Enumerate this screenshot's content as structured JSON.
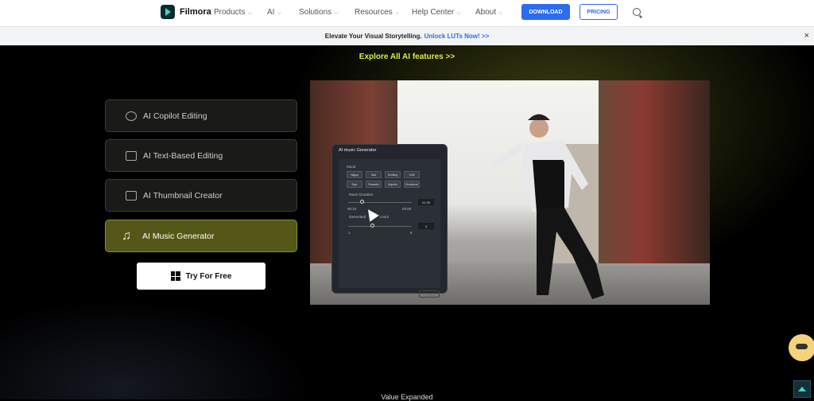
{
  "nav": {
    "brand": "Filmora",
    "items": [
      "Products",
      "AI",
      "Solutions",
      "Resources",
      "Help Center",
      "About"
    ],
    "download": "DOWNLOAD",
    "pricing": "PRICING"
  },
  "banner": {
    "text": "Elevate Your Visual Storytelling.",
    "link": "Unlock LUTs Now! >>",
    "close": "×"
  },
  "hero": {
    "explore": "Explore All AI features >>",
    "features": [
      {
        "label": "AI Copilot Editing",
        "icon": "copilot-icon"
      },
      {
        "label": "AI Text-Based Editing",
        "icon": "text-edit-icon"
      },
      {
        "label": "AI Thumbnail Creator",
        "icon": "thumbnail-icon"
      },
      {
        "label": "AI Music Generator",
        "icon": "music-icon",
        "active": true
      }
    ],
    "try": "Try For Free"
  },
  "panel": {
    "title": "AI music Generator",
    "mood_label": "Mood",
    "moods": [
      "Happy",
      "Sad",
      "Exciting",
      "Chill",
      "Epic",
      "Peaceful",
      "Hopeful",
      "Emotional"
    ],
    "duration_label": "Music Duration",
    "duration_value": "01:30",
    "duration_min": "00:10",
    "duration_max": "03:00",
    "count_label": "Generated",
    "count_label2": "count",
    "count_value": "4",
    "count_min": "1",
    "count_max": "6",
    "start": "Start"
  },
  "footer": {
    "value": "Value Expanded"
  },
  "colors": {
    "accent": "#2d6cf0",
    "highlight": "#d9f03a",
    "active_feature": "#545717"
  }
}
